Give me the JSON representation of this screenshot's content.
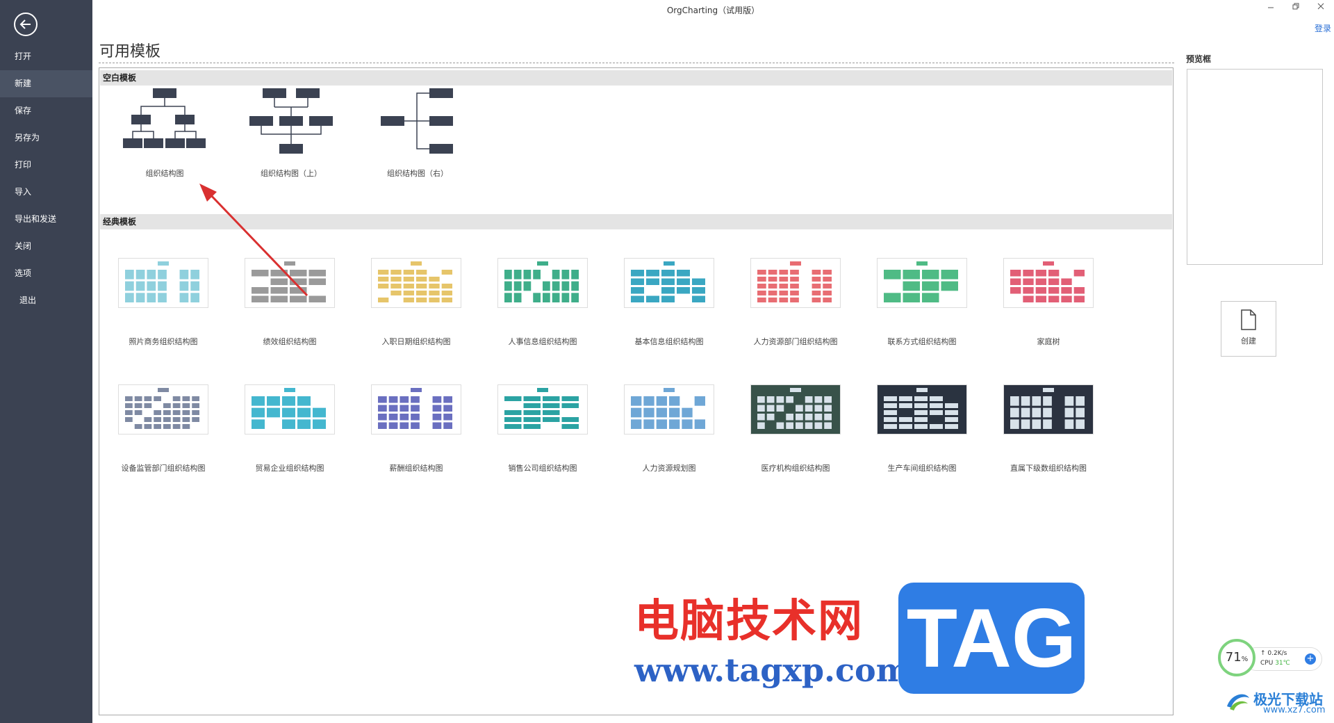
{
  "app": {
    "title": "OrgCharting（试用版）",
    "login": "登录"
  },
  "sidebar": {
    "items": [
      {
        "label": "打开"
      },
      {
        "label": "新建"
      },
      {
        "label": "保存"
      },
      {
        "label": "另存为"
      },
      {
        "label": "打印"
      },
      {
        "label": "导入"
      },
      {
        "label": "导出和发送"
      },
      {
        "label": "关闭"
      },
      {
        "label": "选项"
      },
      {
        "label": "退出"
      }
    ]
  },
  "main": {
    "title": "可用模板",
    "blank_section": "空白模板",
    "blank_templates": [
      {
        "label": "组织结构图"
      },
      {
        "label": "组织结构图（上）"
      },
      {
        "label": "组织结构图（右）"
      }
    ],
    "classic_section": "经典模板",
    "classic_templates": [
      {
        "label": "照片商务组织结构图",
        "color": "#8fd0dd"
      },
      {
        "label": "绩效组织结构图",
        "color": "#9a9a9a"
      },
      {
        "label": "入职日期组织结构图",
        "color": "#e6c56a"
      },
      {
        "label": "人事信息组织结构图",
        "color": "#3fae8a"
      },
      {
        "label": "基本信息组织结构图",
        "color": "#3aa7c2"
      },
      {
        "label": "人力资源部门组织结构图",
        "color": "#e86d73"
      },
      {
        "label": "联系方式组织结构图",
        "color": "#4fbb85"
      },
      {
        "label": "家庭树",
        "color": "#e25f76"
      },
      {
        "label": "设备监管部门组织结构图",
        "color": "#7f8aa3"
      },
      {
        "label": "贸易企业组织结构图",
        "color": "#44b7cf"
      },
      {
        "label": "薪酬组织结构图",
        "color": "#6a6fc0"
      },
      {
        "label": "销售公司组织结构图",
        "color": "#2ba3a3"
      },
      {
        "label": "人力资源规划图",
        "color": "#6fa7d6"
      },
      {
        "label": "医疗机构组织结构图",
        "color": "#38524a"
      },
      {
        "label": "生产车间组织结构图",
        "color": "#2a3340"
      },
      {
        "label": "直属下级数组织结构图",
        "color": "#2b3240"
      }
    ]
  },
  "right": {
    "preview_label": "预览框",
    "create_label": "创建"
  },
  "watermark": {
    "text": "电脑技术网",
    "url": "www.tagxp.com",
    "tag": "TAG"
  },
  "system": {
    "cpu_percent": "71",
    "cpu_unit": "%",
    "net": "0.2K/s",
    "cpu_label": "CPU",
    "cpu_temp": "31℃"
  },
  "brand": {
    "name": "极光下载站",
    "url": "www.xz7.com"
  }
}
